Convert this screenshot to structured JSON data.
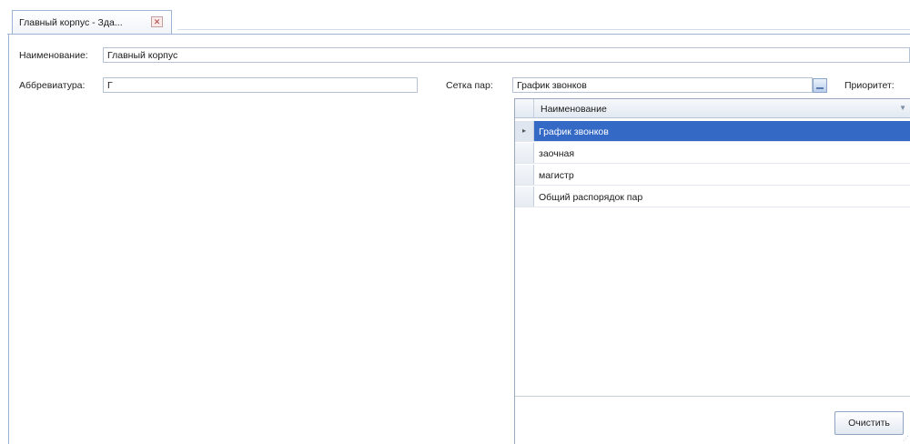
{
  "tab": {
    "title": "Главный корпус - Зда...",
    "close_symbol": "✕"
  },
  "form": {
    "name_label": "Наименование:",
    "name_value": "Главный корпус",
    "abbr_label": "Аббревиатура:",
    "abbr_value": "Г",
    "grid_label": "Сетка пар:",
    "grid_value": "График звонков",
    "priority_label": "Приоритет:"
  },
  "dropdown": {
    "column_header": "Наименование",
    "rows": [
      {
        "label": "График звонков",
        "selected": true,
        "marker": "▸"
      },
      {
        "label": "заочная",
        "selected": false
      },
      {
        "label": "магистр",
        "selected": false
      },
      {
        "label": "Общий распорядок пар",
        "selected": false
      }
    ],
    "clear_button": "Очистить"
  },
  "colors": {
    "selection": "#3469c6",
    "border": "#9db3d3"
  }
}
